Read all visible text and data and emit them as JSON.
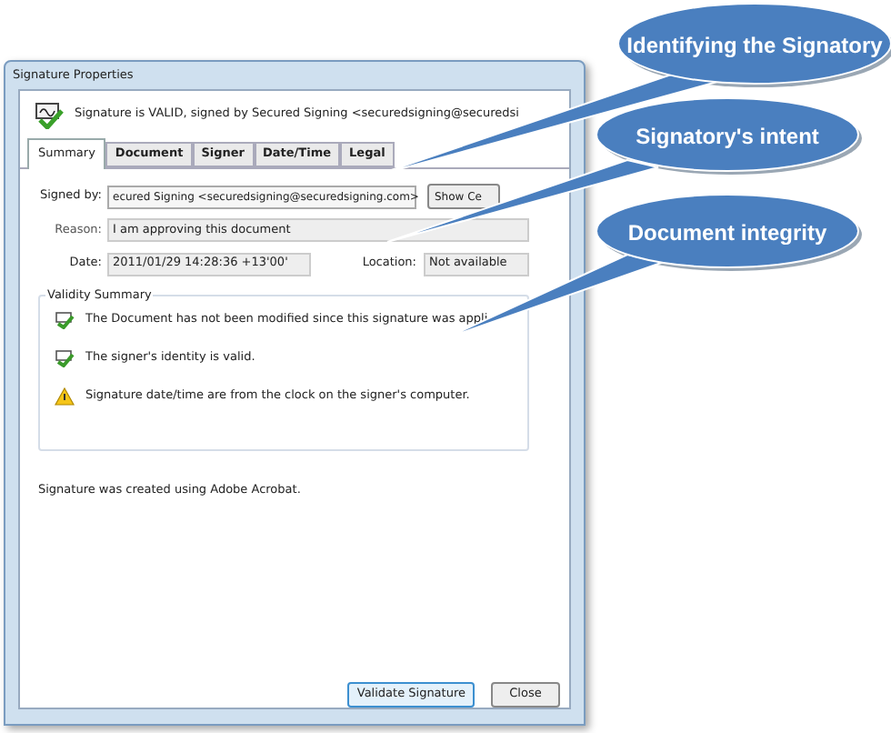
{
  "window": {
    "title": "Signature Properties"
  },
  "header": {
    "text": "Signature is VALID, signed by Secured Signing <securedsigning@securedsi"
  },
  "tabs": [
    {
      "label": "Summary",
      "selected": true
    },
    {
      "label": "Document",
      "selected": false
    },
    {
      "label": "Signer",
      "selected": false
    },
    {
      "label": "Date/Time",
      "selected": false
    },
    {
      "label": "Legal",
      "selected": false
    }
  ],
  "fields": {
    "signed_by": {
      "label": "Signed by:",
      "value": "ecured Signing <securedsigning@securedsigning.com>",
      "button": "Show Ce"
    },
    "reason": {
      "label": "Reason:",
      "value": "I am approving this document"
    },
    "date": {
      "label": "Date:",
      "value": "2011/01/29 14:28:36 +13'00'"
    },
    "location": {
      "label": "Location:",
      "value": "Not available"
    }
  },
  "validity_summary": {
    "title": "Validity Summary",
    "items": [
      {
        "kind": "valid",
        "text": "The Document has not been modified since this signature was appli"
      },
      {
        "kind": "valid",
        "text": "The signer's identity is valid."
      },
      {
        "kind": "warning",
        "text": "Signature date/time are from the clock on the signer's computer."
      }
    ]
  },
  "footer_note": "Signature was created using Adobe Acrobat.",
  "buttons": [
    {
      "label": "Validate Signature",
      "selected": true
    },
    {
      "label": "Close",
      "selected": false
    }
  ],
  "callouts": [
    "Identifying the Signatory",
    "Signatory's intent",
    "Document integrity"
  ]
}
